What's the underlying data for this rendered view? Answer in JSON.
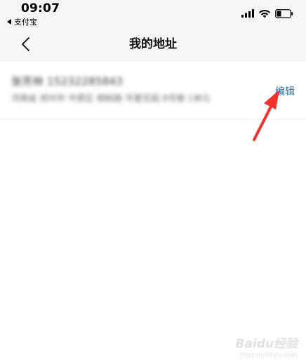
{
  "status_bar": {
    "time": "09:07",
    "back_app_label": "支付宝"
  },
  "nav": {
    "title": "我的地址"
  },
  "address_list": {
    "items": [
      {
        "name_line": "张芳林  15232285843",
        "detail_line": "河南省 郑州市 中原区 桐柏路 华夏花园 8号楼 1单元",
        "edit_label": "编辑"
      }
    ]
  },
  "annotation": {
    "arrow_color": "#f0322b"
  },
  "watermark": {
    "text": "Baidu经验",
    "subtext": "jingyan.baidu.com"
  },
  "colors": {
    "page_background": "#ffffff",
    "bar_background": "#f6f6f6",
    "link": "#1b6fb5"
  }
}
